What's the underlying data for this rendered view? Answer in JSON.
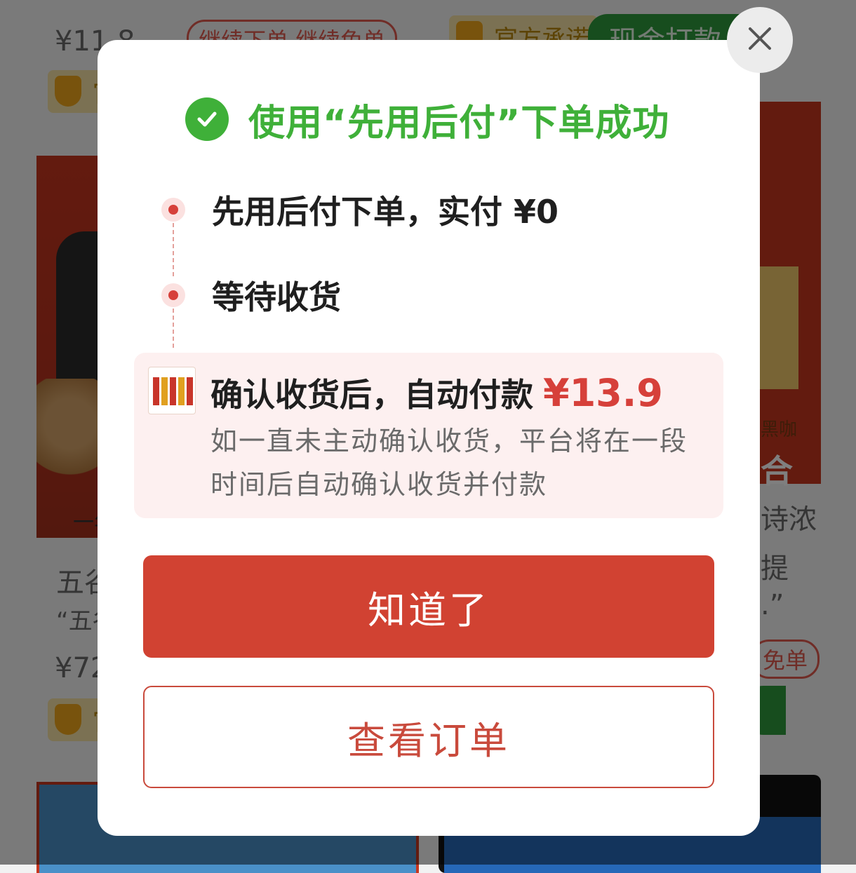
{
  "background": {
    "price_top_left": "¥11.8",
    "pill_top_left": "继续下单 继续免单",
    "badge_top_right": "官方承诺",
    "green_top_right": "现金打款",
    "badge_mid_left": "官",
    "strip_left": "一年",
    "title_left": "五谷",
    "quote_left": "“五谷",
    "price_mid_left": "¥72",
    "badge_bottom_left": "官",
    "tag_right": "黑咖",
    "label_right": "合",
    "text_right_1": "诗浓",
    "text_right_2": "提",
    "text_right_3": ".”",
    "pill_right": "免单"
  },
  "modal": {
    "close_icon": "close-icon",
    "success_icon": "check-circle-icon",
    "title": "使用“先用后付”下单成功",
    "steps": [
      {
        "label": "先用后付下单，实付 ¥0"
      },
      {
        "label": "等待收货"
      }
    ],
    "info": {
      "headline": "确认收货后，自动付款",
      "amount": "¥13.9",
      "description": "如一直未主动确认收货，平台将在一段时间后自动确认收货并付款"
    },
    "primary_button": "知道了",
    "secondary_button": "查看订单"
  },
  "colors": {
    "success_green": "#3fb039",
    "primary_red": "#d14232",
    "price_red": "#d6403a",
    "info_bg": "#fdf0f0"
  }
}
